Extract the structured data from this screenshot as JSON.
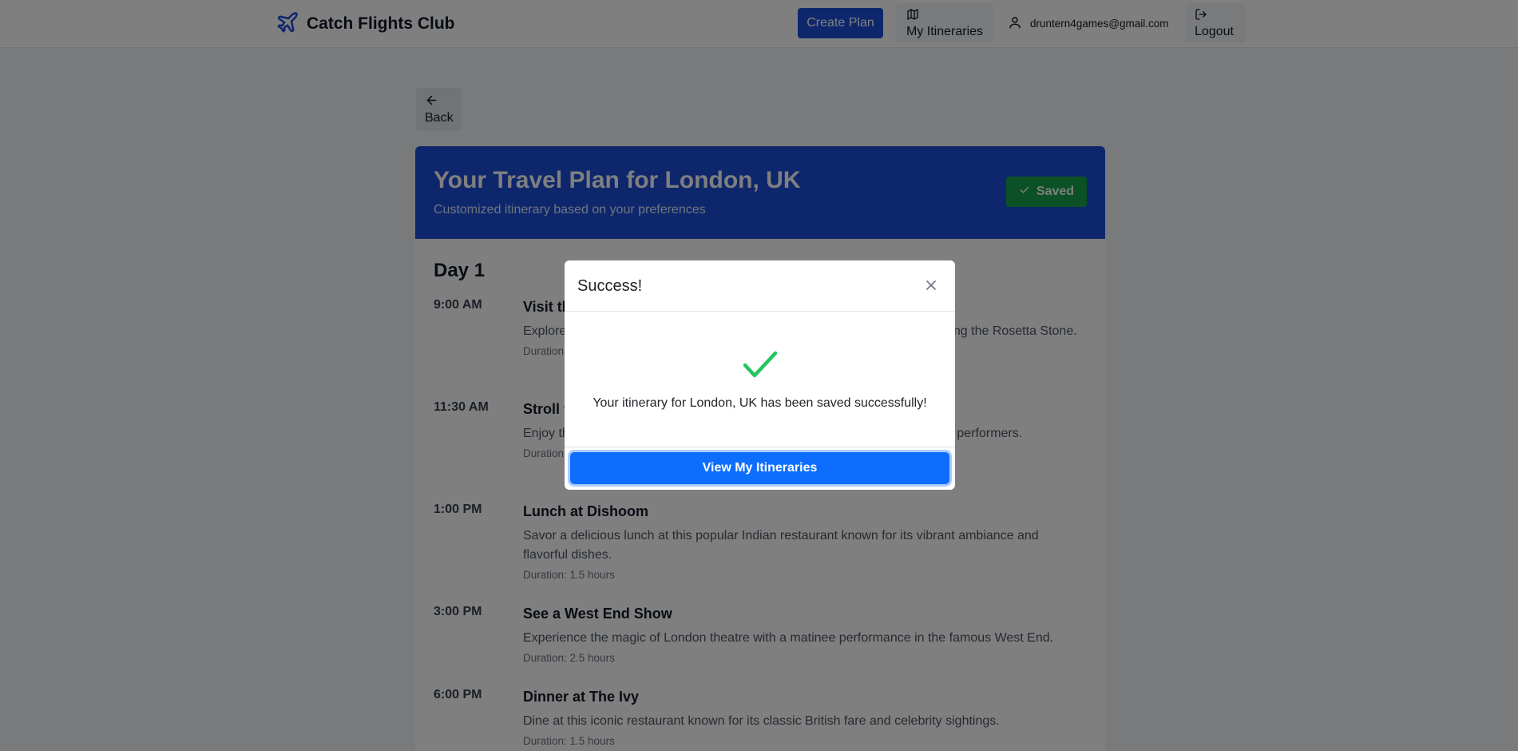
{
  "navbar": {
    "brand": "Catch Flights Club",
    "brand_icon": "plane-icon",
    "create_label": "Create Plan",
    "itineraries_label": "My Itineraries",
    "user_email": "druntern4games@gmail.com",
    "logout_label": "Logout"
  },
  "back_label": "Back",
  "plan": {
    "title": "Your Travel Plan for London, UK",
    "subtitle": "Customized itinerary based on your preferences",
    "saved_label": "Saved",
    "day_title": "Day 1",
    "activities": [
      {
        "time": "9:00 AM",
        "title": "Visit the British Museum",
        "description": "Explore world-famous artifacts and collections at the British Museum, including the Rosetta Stone.",
        "duration": "Duration: 2 hours"
      },
      {
        "time": "11:30 AM",
        "title": "Stroll through Covent Garden",
        "description": "Enjoy the shops, cafes and market stalls of Covent Garden and watch street performers.",
        "duration": "Duration: 1 hour"
      },
      {
        "time": "1:00 PM",
        "title": "Lunch at Dishoom",
        "description": "Savor a delicious lunch at this popular Indian restaurant known for its vibrant ambiance and flavorful dishes.",
        "duration": "Duration: 1.5 hours"
      },
      {
        "time": "3:00 PM",
        "title": "See a West End Show",
        "description": "Experience the magic of London theatre with a matinee performance in the famous West End.",
        "duration": "Duration: 2.5 hours"
      },
      {
        "time": "6:00 PM",
        "title": "Dinner at The Ivy",
        "description": "Dine at this iconic restaurant known for its classic British fare and celebrity sightings.",
        "duration": "Duration: 1.5 hours"
      }
    ]
  },
  "modal": {
    "title": "Success!",
    "message": "Your itinerary for London, UK has been saved successfully!",
    "button_label": "View My Itineraries"
  },
  "colors": {
    "primary": "#1d4ed8",
    "success": "#16a34a",
    "modal_button": "#0d6efd",
    "check": "#22c55e"
  }
}
